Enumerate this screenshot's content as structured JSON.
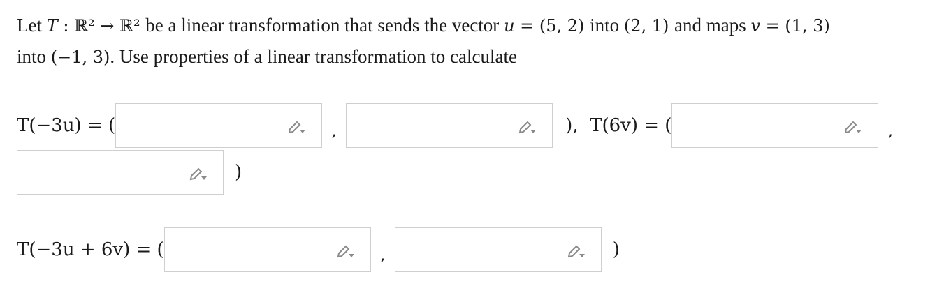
{
  "problem": {
    "p1": "Let ",
    "T": "T",
    "p2": " : ℝ² → ℝ² ",
    "p3": "be a linear transformation that sends the vector ",
    "u": "u",
    "p4": " = (5, 2) ",
    "p5": "into ",
    "p6": "(2, 1) ",
    "p7": "and maps ",
    "v": "v",
    "p8": " = (1, 3)",
    "p9": "into ",
    "p10": "(−1, 3)",
    "p11": ". Use properties of a linear transformation to calculate"
  },
  "row1": {
    "lhs1": "T(−3u) = (",
    "sep": ",",
    "mid": "),  T(6v) = (",
    "sep2": ",",
    "close": ")"
  },
  "row3": {
    "lhs": "T(−3u + 6v) = (",
    "sep": ",",
    "close": ")"
  },
  "colors": {
    "border": "#cfcfcf",
    "icon": "#8a8a8a"
  },
  "icons": {
    "edit": "pencil-dropdown-icon"
  }
}
